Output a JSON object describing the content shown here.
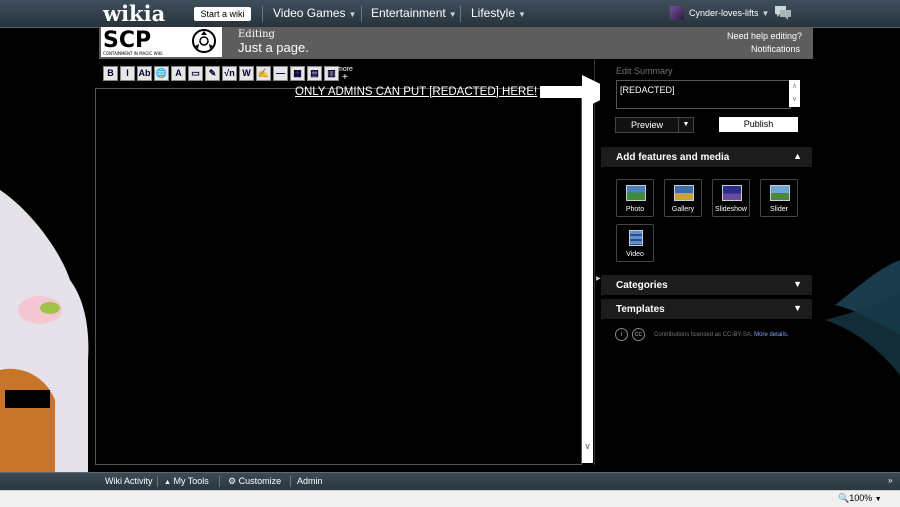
{
  "global_nav": {
    "logo": "wikia",
    "start_wiki": "Start a wiki",
    "items": [
      {
        "label": "Video Games"
      },
      {
        "label": "Entertainment"
      },
      {
        "label": "Lifestyle"
      }
    ],
    "username": "Cynder-loves-lifts"
  },
  "wiki_header": {
    "logo_text": "SCP",
    "logo_subtitle": "CONTAINMENT IN MAGIC WIKI",
    "editing_label": "Editing",
    "page_title": "Just a page.",
    "need_help": "Need help editing?",
    "notifications": "Notifications"
  },
  "editor": {
    "toolbar_buttons": [
      {
        "label": "B"
      },
      {
        "label": "I"
      },
      {
        "label": "Ab"
      },
      {
        "label": "🌐"
      },
      {
        "label": "A"
      },
      {
        "label": "▭"
      },
      {
        "label": "✎"
      },
      {
        "label": "√n"
      },
      {
        "label": "W"
      },
      {
        "label": "✍"
      },
      {
        "label": "—"
      },
      {
        "label": "▦"
      },
      {
        "label": "▤"
      },
      {
        "label": "▥"
      }
    ],
    "more": "more",
    "annotation": "ONLY ADMINS CAN PUT [REDACTED] HERE!"
  },
  "rail": {
    "edit_summary_label": "Edit Summary",
    "edit_summary_value": "[REDACTED]",
    "preview": "Preview",
    "publish": "Publish",
    "features_title": "Add features and media",
    "media": [
      {
        "label": "Photo"
      },
      {
        "label": "Gallery"
      },
      {
        "label": "Slideshow"
      },
      {
        "label": "Slider"
      },
      {
        "label": "Video"
      }
    ],
    "categories": "Categories",
    "templates": "Templates",
    "license_text": "Contributions licensed as CC-BY-SA.",
    "license_link": "More details."
  },
  "bottom_bar": {
    "items": [
      {
        "label": "Wiki Activity"
      },
      {
        "label": "My Tools"
      },
      {
        "label": "Customize"
      },
      {
        "label": "Admin"
      }
    ]
  },
  "status": {
    "zoom": "100%"
  },
  "colors": {
    "nav": "#2e3a43",
    "header": "#5d5d5d",
    "rail_section": "#1c1c1c",
    "link": "#7ea6ff"
  }
}
